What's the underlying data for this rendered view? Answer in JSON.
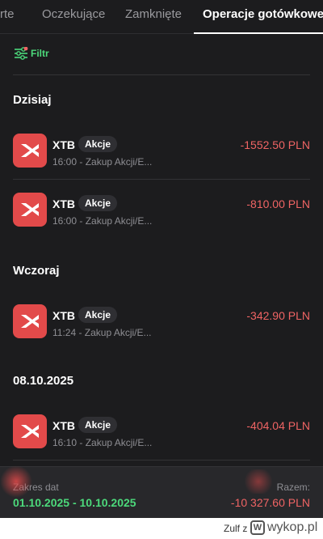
{
  "tabs": [
    {
      "label": "rte"
    },
    {
      "label": "Oczekujące"
    },
    {
      "label": "Zamknięte"
    },
    {
      "label": "Operacje gotówkowe",
      "active": true
    }
  ],
  "filter": {
    "label": "Filtr",
    "icon": "sliders-icon"
  },
  "sections": [
    {
      "title": "Dzisiaj"
    },
    {
      "title": "Wczoraj"
    },
    {
      "title": "08.10.2025"
    }
  ],
  "transactions": [
    {
      "name": "XTB",
      "badge": "Akcje",
      "subtitle": "16:00 - Zakup Akcji/E...",
      "amount": "-1552.50 PLN"
    },
    {
      "name": "XTB",
      "badge": "Akcje",
      "subtitle": "16:00 - Zakup Akcji/E...",
      "amount": "-810.00 PLN"
    },
    {
      "name": "XTB",
      "badge": "Akcje",
      "subtitle": "11:24 - Zakup Akcji/E...",
      "amount": "-342.90 PLN"
    },
    {
      "name": "XTB",
      "badge": "Akcje",
      "subtitle": "16:10 - Zakup Akcji/E...",
      "amount": "-404.04 PLN"
    }
  ],
  "summary": {
    "range_label": "Zakres dat",
    "range_value": "01.10.2025 - 10.10.2025",
    "total_label": "Razem:",
    "total_value": "-10 327.60 PLN"
  },
  "footer": {
    "user": "Zulf z",
    "brand": "wykop.pl"
  },
  "colors": {
    "background": "#1c1c1e",
    "accent_green": "#4cd97b",
    "negative_red": "#f06464",
    "logo_red": "#e24a4a"
  }
}
